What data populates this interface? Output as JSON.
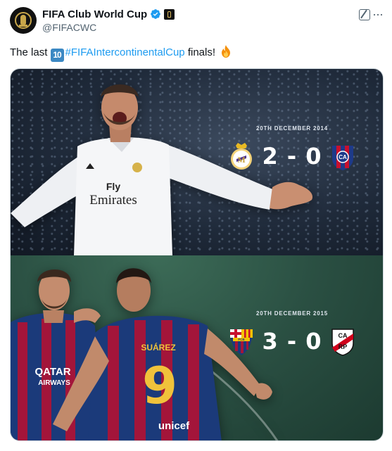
{
  "author": {
    "display_name": "FIFA Club World Cup",
    "handle": "@FIFACWC"
  },
  "icons": {
    "verified": "verified-badge-icon",
    "affiliation": "fifa-affiliate-badge-icon",
    "grok": "grok-icon",
    "more": "more-options-icon",
    "keycap_ten": "keycap-ten-emoji",
    "fire": "fire-emoji"
  },
  "tweet": {
    "prefix": "The last",
    "keycap": "10",
    "hashtag": "#FIFAIntercontinentalCup",
    "suffix": "finals!"
  },
  "media": {
    "match_1": {
      "date": "20TH DECEMBER 2014",
      "score": "2 - 0",
      "home_badge": "real-madrid-crest",
      "away_badge": "san-lorenzo-crest",
      "shirt_sponsor_line1": "Fly",
      "shirt_sponsor_line2": "Emirates"
    },
    "match_2": {
      "date": "20TH DECEMBER 2015",
      "score": "3 - 0",
      "home_badge": "fc-barcelona-crest",
      "away_badge": "river-plate-crest",
      "shirt_number": "9",
      "shirt_name": "SUÁREZ",
      "shirt_sponsor": "unicef",
      "left_shirt_sponsor_line1": "QATAR",
      "left_shirt_sponsor_line2": "AIRWAYS"
    }
  },
  "colors": {
    "link": "#1d9bf0",
    "verified": "#1d9bf0",
    "secondary_text": "#536471",
    "barca_blue": "#1b3a7a",
    "barca_red": "#a3153a"
  }
}
